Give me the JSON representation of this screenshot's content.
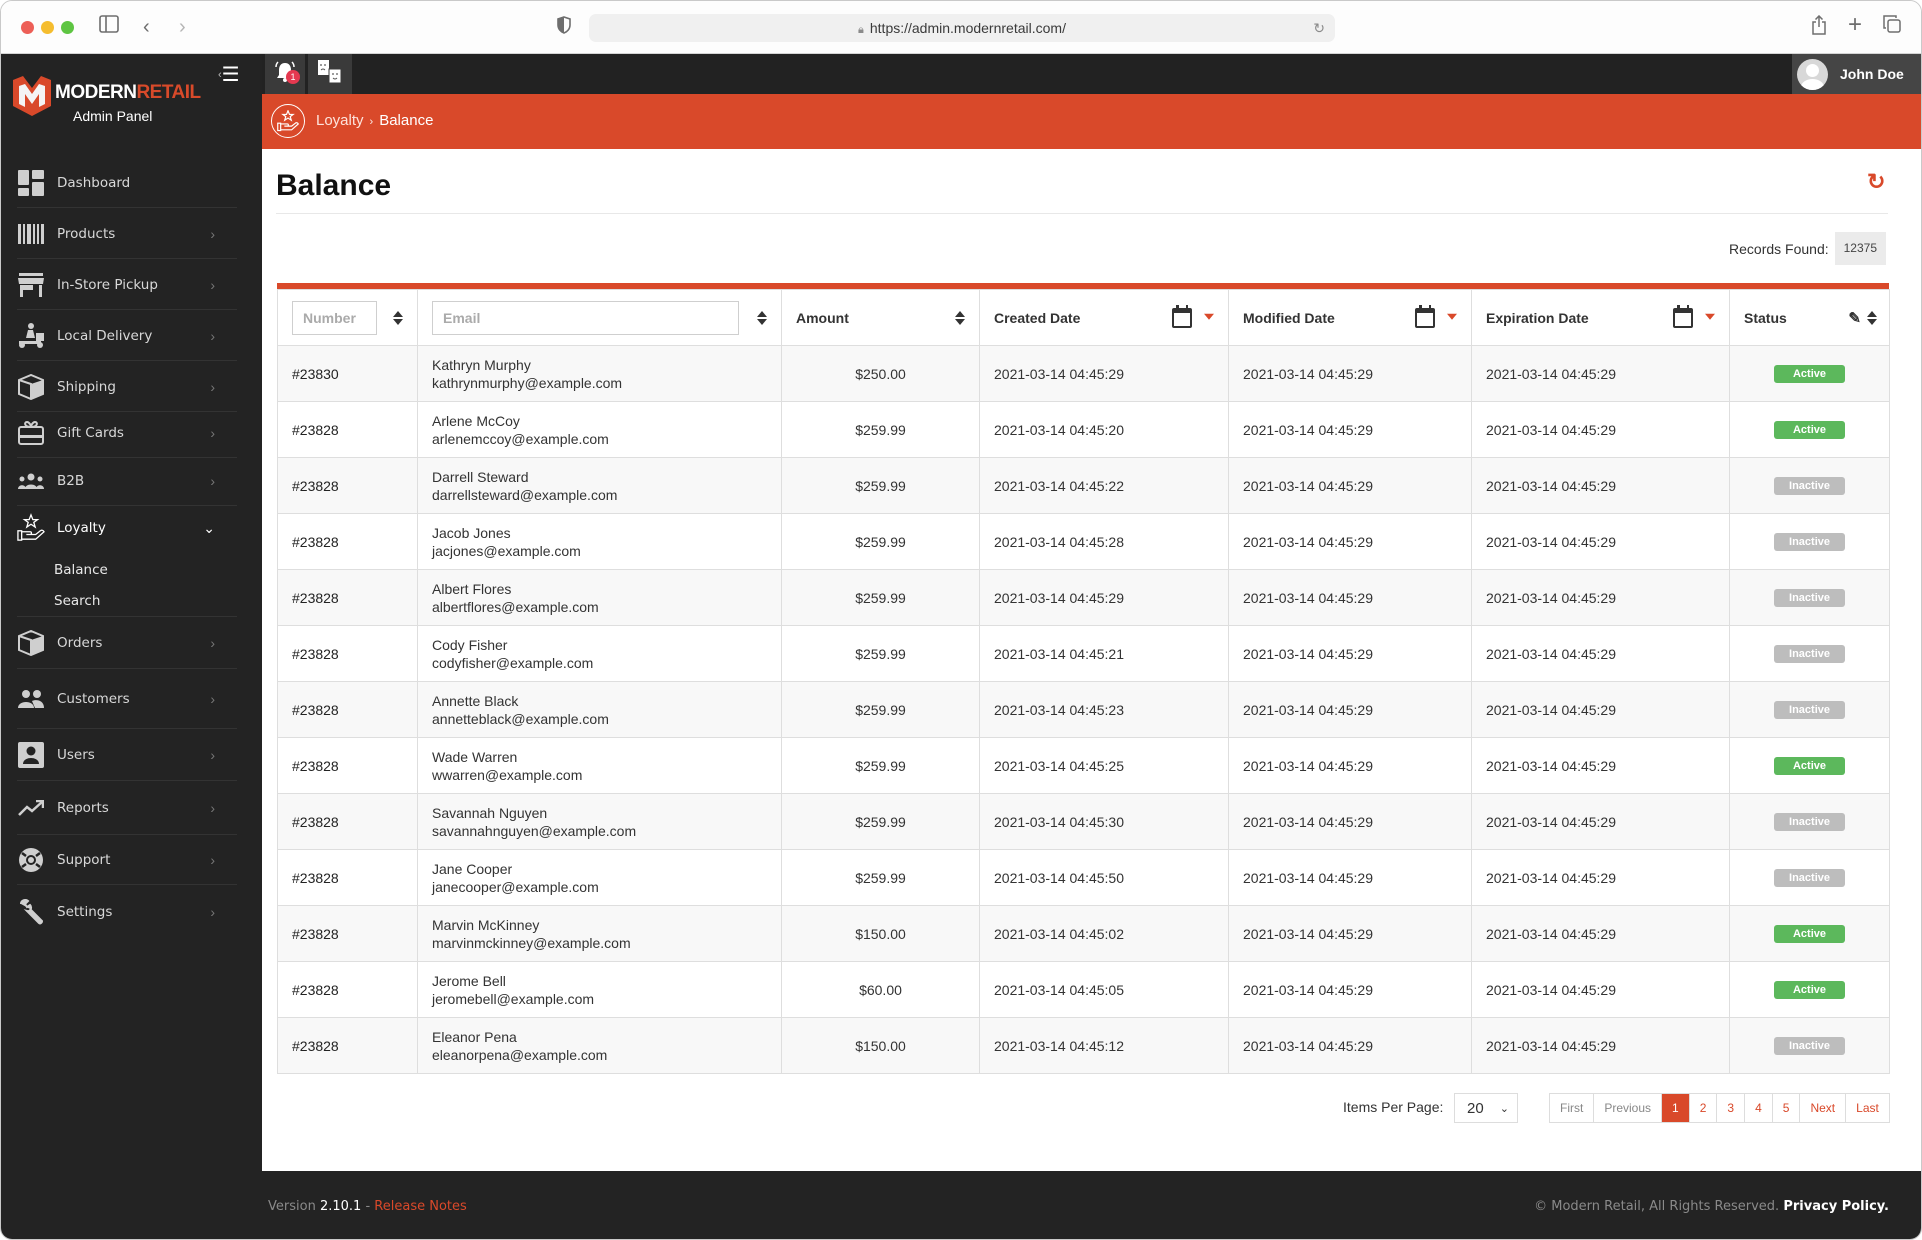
{
  "browser": {
    "url": "https://admin.modernretail.com/"
  },
  "brand": {
    "name_part1": "MODERN",
    "name_part2": "RETAIL",
    "subtitle": "Admin Panel",
    "accent_color": "#d9492a"
  },
  "topbar": {
    "notification_count": "1",
    "user_name": "John Doe"
  },
  "sidebar": {
    "items": [
      {
        "label": "Dashboard",
        "icon": "dashboard-icon",
        "has_chevron": false
      },
      {
        "label": "Products",
        "icon": "barcode-icon",
        "has_chevron": true
      },
      {
        "label": "In-Store Pickup",
        "icon": "store-icon",
        "has_chevron": true
      },
      {
        "label": "Local Delivery",
        "icon": "scooter-icon",
        "has_chevron": true
      },
      {
        "label": "Shipping",
        "icon": "box-icon",
        "has_chevron": true
      },
      {
        "label": "Gift Cards",
        "icon": "gift-card-icon",
        "has_chevron": true
      },
      {
        "label": "B2B",
        "icon": "group-icon",
        "has_chevron": true
      },
      {
        "label": "Loyalty",
        "icon": "loyalty-hand-star-icon",
        "has_chevron": true,
        "expanded": true,
        "children": [
          {
            "label": "Balance"
          },
          {
            "label": "Search"
          }
        ]
      },
      {
        "label": "Orders",
        "icon": "box-icon",
        "has_chevron": true
      },
      {
        "label": "Customers",
        "icon": "people-icon",
        "has_chevron": true
      },
      {
        "label": "Users",
        "icon": "user-card-icon",
        "has_chevron": true
      },
      {
        "label": "Reports",
        "icon": "trending-up-icon",
        "has_chevron": true
      },
      {
        "label": "Support",
        "icon": "lifebuoy-icon",
        "has_chevron": true
      },
      {
        "label": "Settings",
        "icon": "wrench-icon",
        "has_chevron": true
      }
    ]
  },
  "breadcrumb": {
    "parent": "Loyalty",
    "separator": "›",
    "current": "Balance"
  },
  "page": {
    "title": "Balance",
    "records_label": "Records Found:",
    "records_count": "12375"
  },
  "table": {
    "filters": {
      "number_placeholder": "Number",
      "email_placeholder": "Email"
    },
    "columns": [
      "Number",
      "Email",
      "Amount",
      "Created Date",
      "Modified Date",
      "Expiration Date",
      "Status"
    ],
    "rows": [
      {
        "number": "#23830",
        "name": "Kathryn Murphy",
        "email": "kathrynmurphy@example.com",
        "amount": "$250.00",
        "created": "2021-03-14 04:45:29",
        "modified": "2021-03-14 04:45:29",
        "expiration": "2021-03-14 04:45:29",
        "status": "Active"
      },
      {
        "number": "#23828",
        "name": "Arlene McCoy",
        "email": "arlenemccoy@example.com",
        "amount": "$259.99",
        "created": "2021-03-14 04:45:20",
        "modified": "2021-03-14 04:45:29",
        "expiration": "2021-03-14 04:45:29",
        "status": "Active"
      },
      {
        "number": "#23828",
        "name": "Darrell Steward",
        "email": "darrellsteward@example.com",
        "amount": "$259.99",
        "created": "2021-03-14 04:45:22",
        "modified": "2021-03-14 04:45:29",
        "expiration": "2021-03-14 04:45:29",
        "status": "Inactive"
      },
      {
        "number": "#23828",
        "name": "Jacob Jones",
        "email": "jacjones@example.com",
        "amount": "$259.99",
        "created": "2021-03-14 04:45:28",
        "modified": "2021-03-14 04:45:29",
        "expiration": "2021-03-14 04:45:29",
        "status": "Inactive"
      },
      {
        "number": "#23828",
        "name": "Albert Flores",
        "email": "albertflores@example.com",
        "amount": "$259.99",
        "created": "2021-03-14 04:45:29",
        "modified": "2021-03-14 04:45:29",
        "expiration": "2021-03-14 04:45:29",
        "status": "Inactive"
      },
      {
        "number": "#23828",
        "name": "Cody Fisher",
        "email": "codyfisher@example.com",
        "amount": "$259.99",
        "created": "2021-03-14 04:45:21",
        "modified": "2021-03-14 04:45:29",
        "expiration": "2021-03-14 04:45:29",
        "status": "Inactive"
      },
      {
        "number": "#23828",
        "name": "Annette Black",
        "email": "annetteblack@example.com",
        "amount": "$259.99",
        "created": "2021-03-14 04:45:23",
        "modified": "2021-03-14 04:45:29",
        "expiration": "2021-03-14 04:45:29",
        "status": "Inactive"
      },
      {
        "number": "#23828",
        "name": "Wade Warren",
        "email": "wwarren@example.com",
        "amount": "$259.99",
        "created": "2021-03-14 04:45:25",
        "modified": "2021-03-14 04:45:29",
        "expiration": "2021-03-14 04:45:29",
        "status": "Active"
      },
      {
        "number": "#23828",
        "name": "Savannah Nguyen",
        "email": "savannahnguyen@example.com",
        "amount": "$259.99",
        "created": "2021-03-14 04:45:30",
        "modified": "2021-03-14 04:45:29",
        "expiration": "2021-03-14 04:45:29",
        "status": "Inactive"
      },
      {
        "number": "#23828",
        "name": "Jane Cooper",
        "email": "janecooper@example.com",
        "amount": "$259.99",
        "created": "2021-03-14 04:45:50",
        "modified": "2021-03-14 04:45:29",
        "expiration": "2021-03-14 04:45:29",
        "status": "Inactive"
      },
      {
        "number": "#23828",
        "name": "Marvin McKinney",
        "email": "marvinmckinney@example.com",
        "amount": "$150.00",
        "created": "2021-03-14 04:45:02",
        "modified": "2021-03-14 04:45:29",
        "expiration": "2021-03-14 04:45:29",
        "status": "Active"
      },
      {
        "number": "#23828",
        "name": "Jerome Bell",
        "email": "jeromebell@example.com",
        "amount": "$60.00",
        "created": "2021-03-14 04:45:05",
        "modified": "2021-03-14 04:45:29",
        "expiration": "2021-03-14 04:45:29",
        "status": "Active"
      },
      {
        "number": "#23828",
        "name": "Eleanor Pena",
        "email": "eleanorpena@example.com",
        "amount": "$150.00",
        "created": "2021-03-14 04:45:12",
        "modified": "2021-03-14 04:45:29",
        "expiration": "2021-03-14 04:45:29",
        "status": "Inactive"
      }
    ],
    "status_colors": {
      "Active": "#5cb85c",
      "Inactive": "#bdbdbd"
    }
  },
  "pagination": {
    "items_per_page_label": "Items Per Page:",
    "items_per_page_value": "20",
    "first": "First",
    "previous": "Previous",
    "pages": [
      "1",
      "2",
      "3",
      "4",
      "5"
    ],
    "current_page": "1",
    "next": "Next",
    "last": "Last"
  },
  "footer": {
    "version_label": "Version",
    "version": "2.10.1",
    "separator": "-",
    "release_notes": "Release Notes",
    "copyright": "© Modern Retail, All Rights Reserved.",
    "privacy": "Privacy Policy."
  }
}
